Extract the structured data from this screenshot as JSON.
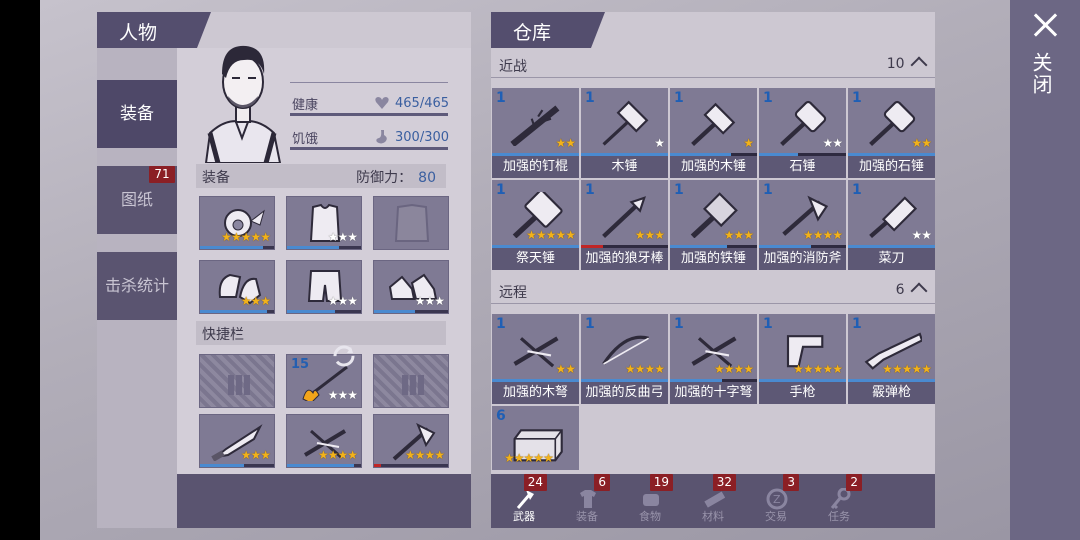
{
  "close": {
    "label": "关闭"
  },
  "character": {
    "title": "人物",
    "side_tabs": [
      {
        "label": "装备",
        "active": true
      },
      {
        "label": "图纸",
        "badge": "71"
      },
      {
        "label": "击杀统计"
      }
    ],
    "stats": {
      "health_label": "健康",
      "health_value": "465/465",
      "health_fill": 1.0,
      "hunger_label": "饥饿",
      "hunger_value": "300/300",
      "hunger_fill": 1.0
    },
    "equip_section": {
      "label": "装备",
      "defense_label": "防御力：",
      "defense_value": "80"
    },
    "equipment": [
      {
        "icon": "gas-mask-icon",
        "stars": 5,
        "gold": 5,
        "fill": 0.85
      },
      {
        "icon": "vest-icon",
        "stars": 3,
        "gold": 0,
        "fill": 0.7
      },
      {
        "icon": "jacket-icon",
        "stars": 0,
        "gold": 0,
        "empty": true
      },
      {
        "icon": "gloves-icon",
        "stars": 3,
        "gold": 3,
        "fill": 0.9
      },
      {
        "icon": "shorts-icon",
        "stars": 3,
        "gold": 0,
        "fill": 0.65
      },
      {
        "icon": "sneakers-icon",
        "stars": 3,
        "gold": 0,
        "fill": 0.55
      }
    ],
    "quickbar_label": "快捷栏",
    "quickbar": [
      {
        "icon": "ammo-icon",
        "empty": true
      },
      {
        "icon": "fire-arrow-icon",
        "count": "15",
        "stars": 3,
        "gold": 0,
        "refresh": true
      },
      {
        "icon": "ammo-icon",
        "empty": true
      },
      {
        "icon": "machete-icon",
        "stars": 3,
        "gold": 3,
        "fill": 0.6
      },
      {
        "icon": "crossbow-icon",
        "stars": 4,
        "gold": 4,
        "fill": 0.9
      },
      {
        "icon": "fire-axe-icon",
        "stars": 4,
        "gold": 4,
        "fill": 0.1,
        "red": true
      }
    ]
  },
  "storage": {
    "title": "仓库",
    "melee": {
      "label": "近战",
      "count": "10"
    },
    "ranged": {
      "label": "远程",
      "count": "6"
    },
    "melee_items": [
      {
        "name": "加强的钉棍",
        "count": "1",
        "gold": 2,
        "stars": 2,
        "icon": "spiked-club-icon",
        "fill": 1.0
      },
      {
        "name": "木锤",
        "count": "1",
        "gold": 0,
        "stars": 1,
        "icon": "mallet-icon",
        "fill": 1.0
      },
      {
        "name": "加强的木锤",
        "count": "1",
        "gold": 1,
        "stars": 1,
        "icon": "hammer-icon",
        "fill": 0.7
      },
      {
        "name": "石锤",
        "count": "1",
        "gold": 0,
        "stars": 2,
        "icon": "stone-hammer-icon",
        "fill": 0.45
      },
      {
        "name": "加强的石锤",
        "count": "1",
        "gold": 2,
        "stars": 2,
        "icon": "stone-hammer-icon",
        "fill": 1.0
      },
      {
        "name": "祭天锤",
        "count": "1",
        "gold": 5,
        "stars": 5,
        "icon": "war-hammer-icon",
        "fill": 1.0
      },
      {
        "name": "加强的狼牙棒",
        "count": "1",
        "gold": 3,
        "stars": 3,
        "icon": "mace-icon",
        "fill": 0.25,
        "red": true
      },
      {
        "name": "加强的铁锤",
        "count": "1",
        "gold": 3,
        "stars": 3,
        "icon": "iron-hammer-icon",
        "fill": 0.65
      },
      {
        "name": "加强的消防斧",
        "count": "1",
        "gold": 4,
        "stars": 4,
        "icon": "fire-axe-icon",
        "fill": 0.6
      },
      {
        "name": "菜刀",
        "count": "1",
        "gold": 0,
        "stars": 2,
        "icon": "cleaver-icon",
        "fill": 1.0
      }
    ],
    "ranged_items": [
      {
        "name": "加强的木弩",
        "count": "1",
        "gold": 2,
        "stars": 2,
        "icon": "crossbow-icon",
        "fill": 1.0
      },
      {
        "name": "加强的反曲弓",
        "count": "1",
        "gold": 4,
        "stars": 4,
        "icon": "bow-icon",
        "fill": 1.0
      },
      {
        "name": "加强的十字弩",
        "count": "1",
        "gold": 4,
        "stars": 4,
        "icon": "crossbow-icon",
        "fill": 0.6
      },
      {
        "name": "手枪",
        "count": "1",
        "gold": 5,
        "stars": 5,
        "icon": "pistol-icon",
        "fill": 1.0
      },
      {
        "name": "霰弹枪",
        "count": "1",
        "gold": 5,
        "stars": 5,
        "icon": "shotgun-icon",
        "fill": 1.0
      },
      {
        "name": "",
        "count": "6",
        "gold": 5,
        "stars": 5,
        "icon": "brick-icon",
        "nobar": true
      }
    ],
    "bottom_tabs": [
      {
        "label": "武器",
        "badge": "24",
        "icon": "axe-icon",
        "active": true
      },
      {
        "label": "装备",
        "badge": "6",
        "icon": "shirt-icon"
      },
      {
        "label": "食物",
        "badge": "19",
        "icon": "food-icon"
      },
      {
        "label": "材料",
        "badge": "32",
        "icon": "plank-icon"
      },
      {
        "label": "交易",
        "badge": "3",
        "icon": "trade-coin-icon"
      },
      {
        "label": "任务",
        "badge": "2",
        "icon": "key-icon"
      }
    ]
  }
}
